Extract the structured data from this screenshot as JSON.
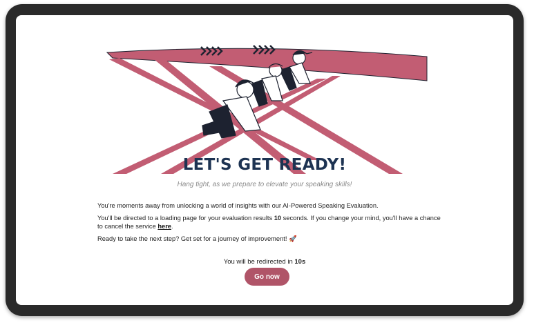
{
  "colors": {
    "accent": "#c25d73",
    "title": "#1d3352",
    "button": "#b05468",
    "frame": "#2a2a2a"
  },
  "hero": {
    "illustration": "runners-starting-on-track"
  },
  "heading": {
    "title": "LET'S GET READY!",
    "subtitle": "Hang tight, as we prepare to elevate your speaking skills!"
  },
  "body": {
    "p1": "You're moments away from unlocking a world of insights with our AI-Powered Speaking Evaluation.",
    "p2_prefix": "You'll be directed to a loading page for your evaluation results ",
    "p2_seconds": "10",
    "p2_middle": " seconds. If you change your mind, you'll have a chance to cancel the service ",
    "p2_link": "here",
    "p2_suffix": ".",
    "p3": "Ready to take the next step? Get set for a journey of improvement! 🚀"
  },
  "redirect": {
    "prefix": "You will be redirected in ",
    "countdown": "10s"
  },
  "button": {
    "label": "Go now"
  }
}
